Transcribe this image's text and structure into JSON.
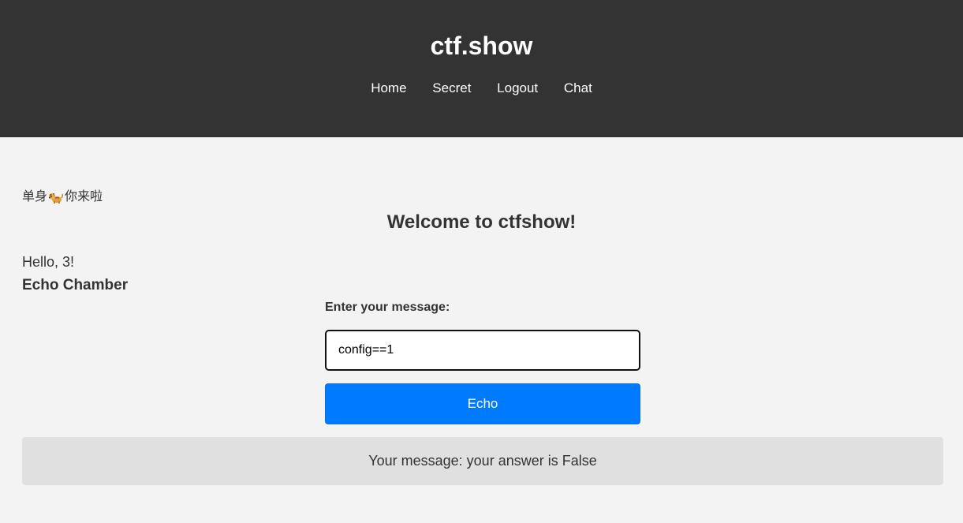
{
  "header": {
    "site_title": "ctf.show",
    "nav": [
      {
        "label": "Home"
      },
      {
        "label": "Secret"
      },
      {
        "label": "Logout"
      },
      {
        "label": "Chat"
      }
    ],
    "background_color": "#333333"
  },
  "main": {
    "greeting_before_icon": "单身",
    "greeting_icon": "dog-icon",
    "greeting_after_icon": "你来啦",
    "welcome_heading": "Welcome to ctfshow!",
    "hello_text": "Hello, 3!",
    "section_title": "Echo Chamber",
    "form": {
      "label": "Enter your message:",
      "input_value": "config==1",
      "button_label": "Echo",
      "button_color": "#007bff"
    },
    "result_text": "Your message: your answer is False"
  }
}
